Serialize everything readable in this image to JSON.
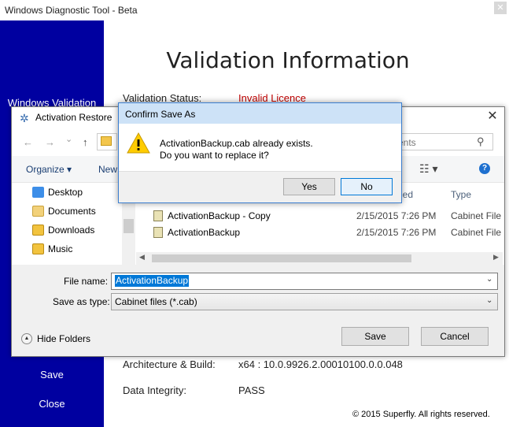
{
  "app": {
    "title": "Windows Diagnostic Tool - Beta",
    "close_glyph": "✕",
    "heading": "Validation Information",
    "sidebar": {
      "items": [
        {
          "label": "Windows Validation"
        },
        {
          "label": "Save"
        },
        {
          "label": "Close"
        }
      ]
    },
    "info": {
      "status_label": "Validation Status:",
      "status_value": "Invalid Licence",
      "arch_label": "Architecture & Build:",
      "arch_value": "x64 : 10.0.9926.2.00010100.0.0.048",
      "integrity_label": "Data Integrity:",
      "integrity_value": "PASS"
    },
    "copyright": "© 2015 Superfly. All rights reserved.",
    "colors": {
      "sidebar": "#0000a0",
      "status_invalid": "#c00000"
    }
  },
  "save_dialog": {
    "title": "Activation Restore",
    "close_glyph": "✕",
    "nav": {
      "back": "←",
      "forward": "→",
      "dropdown": "⌄",
      "up": "↑"
    },
    "search_placeholder_visible": "ents",
    "toolbar": {
      "organize": "Organize ▾",
      "new_folder": "New",
      "view_glyph": "☷ ▾",
      "help_glyph": "?"
    },
    "nav_pane": {
      "items": [
        {
          "label": "Desktop",
          "icon": "desktop-folder-icon"
        },
        {
          "label": "Documents",
          "icon": "documents-folder-icon"
        },
        {
          "label": "Downloads",
          "icon": "downloads-folder-icon"
        },
        {
          "label": "Music",
          "icon": "music-folder-icon"
        }
      ]
    },
    "columns": {
      "date_partial": "ied",
      "type": "Type"
    },
    "files": [
      {
        "name": "ActivationBackup - Copy",
        "date": "2/15/2015 7:26 PM",
        "type": "Cabinet File"
      },
      {
        "name": "ActivationBackup",
        "date": "2/15/2015 7:26 PM",
        "type": "Cabinet File"
      }
    ],
    "file_name_label": "File name:",
    "file_name_value": "ActivationBackup",
    "save_type_label": "Save as type:",
    "save_type_value": "Cabinet files (*.cab)",
    "dropdown_glyph": "⌄",
    "hide_folders": "Hide Folders",
    "hide_glyph": "▲",
    "save_button": "Save",
    "cancel_button": "Cancel"
  },
  "confirm_dialog": {
    "title": "Confirm Save As",
    "message_line1": "ActivationBackup.cab already exists.",
    "message_line2": "Do you want to replace it?",
    "yes_button": "Yes",
    "no_button": "No",
    "icon": "warning-icon"
  }
}
